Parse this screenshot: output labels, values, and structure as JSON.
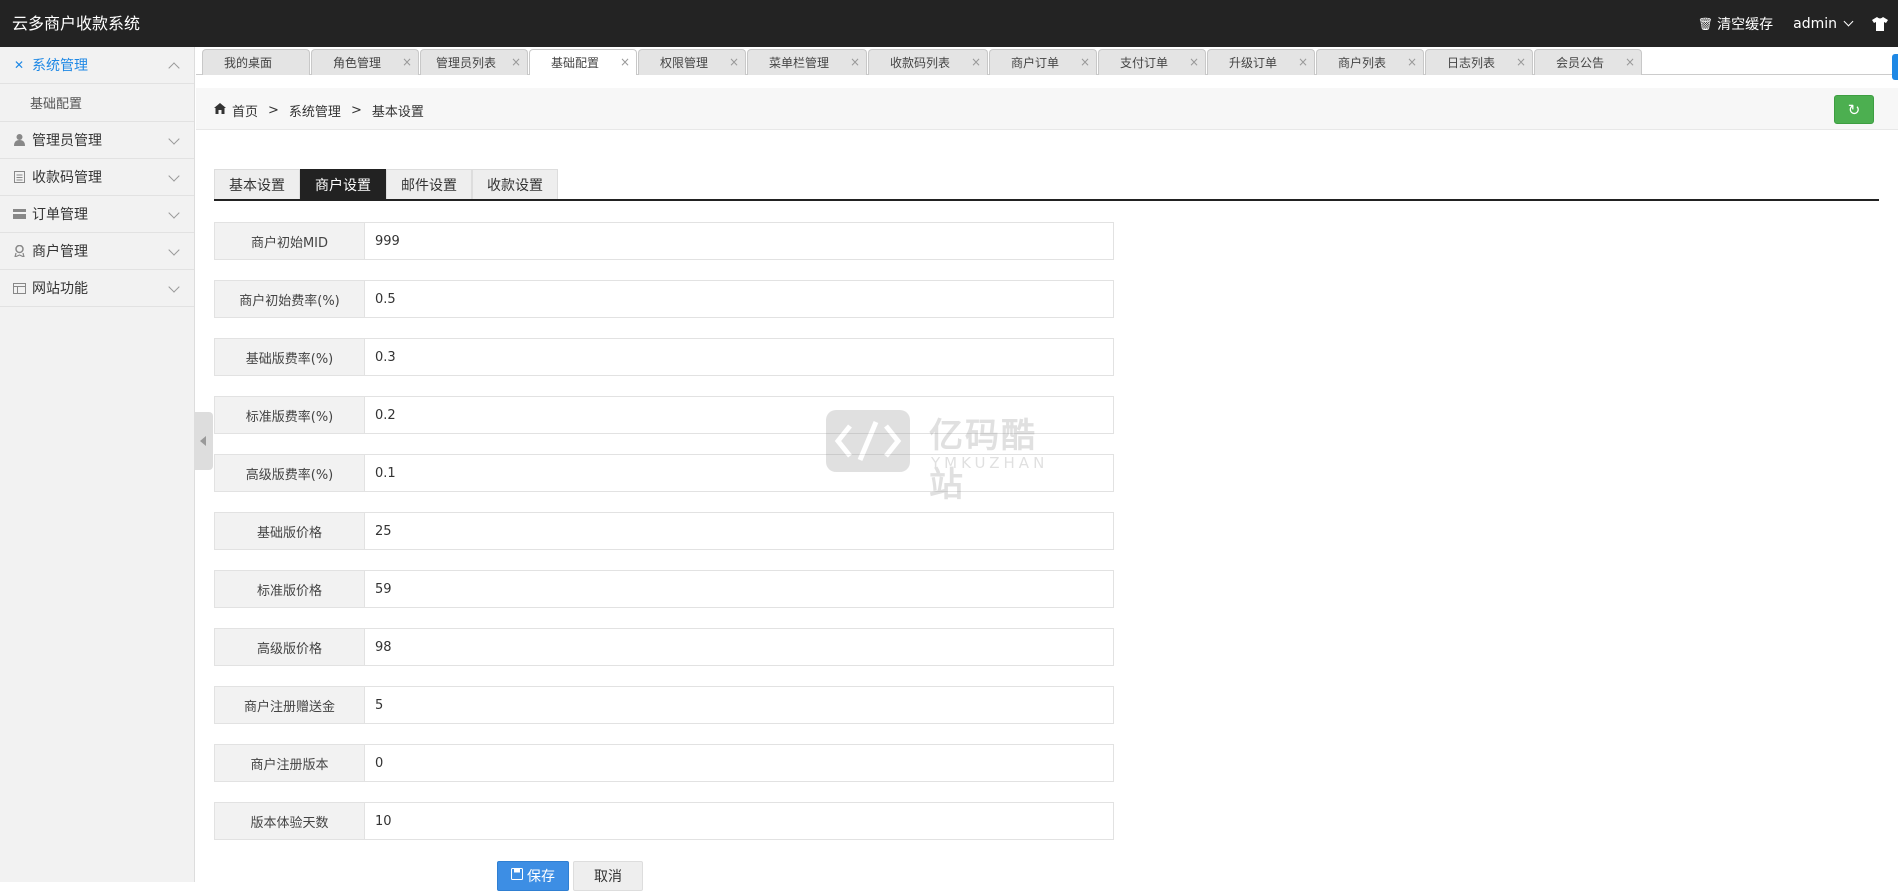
{
  "header": {
    "app_title": "云多商户收款系统",
    "clear_cache": "清空缓存",
    "user": "admin"
  },
  "sidebar": {
    "items": [
      {
        "label": "系统管理",
        "icon": "tools-icon"
      },
      {
        "label": "管理员管理",
        "icon": "user-icon"
      },
      {
        "label": "收款码管理",
        "icon": "document-icon"
      },
      {
        "label": "订单管理",
        "icon": "card-icon"
      },
      {
        "label": "商户管理",
        "icon": "merchant-icon"
      },
      {
        "label": "网站功能",
        "icon": "window-icon"
      }
    ],
    "sub_item": "基础配置"
  },
  "tabs": [
    "我的桌面",
    "角色管理",
    "管理员列表",
    "基础配置",
    "权限管理",
    "菜单栏管理",
    "收款码列表",
    "商户订单",
    "支付订单",
    "升级订单",
    "商户列表",
    "日志列表",
    "会员公告"
  ],
  "active_tab": "基础配置",
  "breadcrumb": {
    "home": "首页",
    "level1": "系统管理",
    "level2": "基本设置",
    "separator": ">"
  },
  "subtabs": [
    "基本设置",
    "商户设置",
    "邮件设置",
    "收款设置"
  ],
  "active_subtab": "商户设置",
  "form": {
    "fields": [
      {
        "label": "商户初始MID",
        "value": "999"
      },
      {
        "label": "商户初始费率(%)",
        "value": "0.5"
      },
      {
        "label": "基础版费率(%)",
        "value": "0.3"
      },
      {
        "label": "标准版费率(%)",
        "value": "0.2"
      },
      {
        "label": "高级版费率(%)",
        "value": "0.1"
      },
      {
        "label": "基础版价格",
        "value": "25"
      },
      {
        "label": "标准版价格",
        "value": "59"
      },
      {
        "label": "高级版价格",
        "value": "98"
      },
      {
        "label": "商户注册赠送金",
        "value": "5"
      },
      {
        "label": "商户注册版本",
        "value": "0"
      },
      {
        "label": "版本体验天数",
        "value": "10"
      }
    ],
    "save": "保存",
    "cancel": "取消"
  },
  "watermark": {
    "text": "亿码酷站",
    "subtext": "YMKUZHAN"
  },
  "colors": {
    "topbar": "#232323",
    "accent": "#1e88e5",
    "refresh": "#4caf50",
    "save": "#3d8ee4"
  }
}
